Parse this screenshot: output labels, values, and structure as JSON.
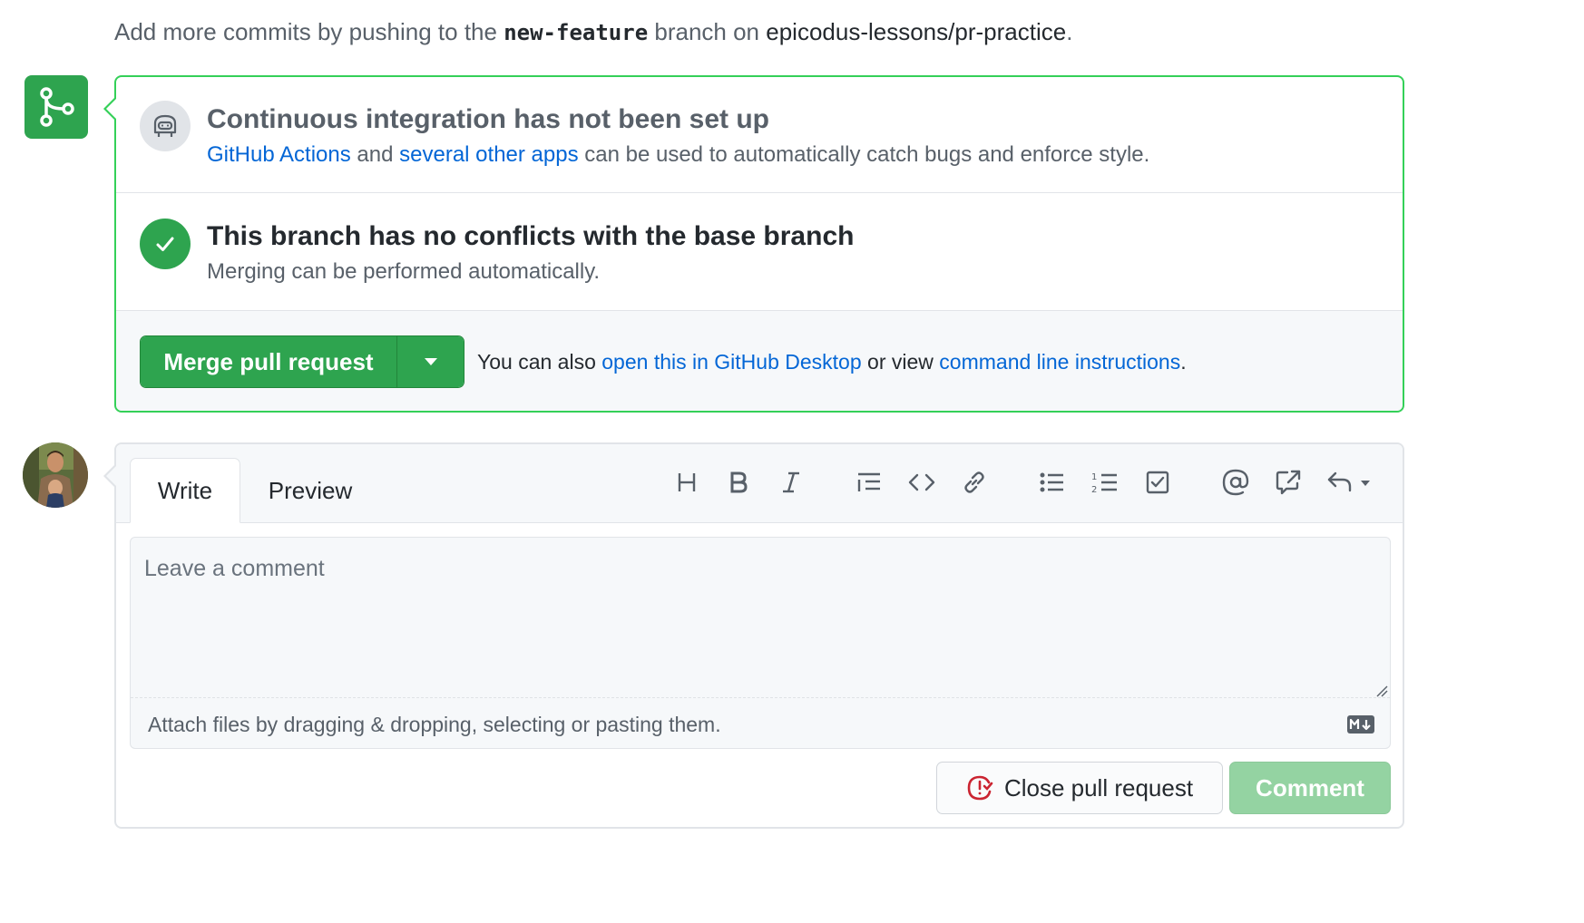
{
  "intro": {
    "prefix": "Add more commits by pushing to the ",
    "branch": "new-feature",
    "middle": " branch on ",
    "repo": "epicodus-lessons/pr-practice",
    "suffix": "."
  },
  "ci": {
    "title": "Continuous integration has not been set up",
    "link1": "GitHub Actions",
    "text1": " and ",
    "link2": "several other apps",
    "text2": " can be used to automatically catch bugs and enforce style."
  },
  "conflicts": {
    "title": "This branch has no conflicts with the base branch",
    "desc": "Merging can be performed automatically."
  },
  "merge": {
    "button_label": "Merge pull request",
    "also_prefix": "You can also ",
    "desktop_link": "open this in GitHub Desktop",
    "also_middle": " or view ",
    "cli_link": "command line instructions",
    "also_suffix": "."
  },
  "comment": {
    "tabs": {
      "write": "Write",
      "preview": "Preview"
    },
    "toolbar_icons": [
      "heading-icon",
      "bold-icon",
      "italic-icon",
      "quote-icon",
      "code-icon",
      "link-icon",
      "bulleted-list-icon",
      "numbered-list-icon",
      "task-list-icon",
      "mention-icon",
      "cross-reference-icon",
      "reply-icon"
    ],
    "placeholder": "Leave a comment",
    "attach_text": "Attach files by dragging & dropping, selecting or pasting them.",
    "close_button": "Close pull request",
    "comment_button": "Comment"
  },
  "colors": {
    "green": "#2ea44f",
    "green_border": "#34d058",
    "link": "#0366d6",
    "danger": "#cb2431"
  }
}
